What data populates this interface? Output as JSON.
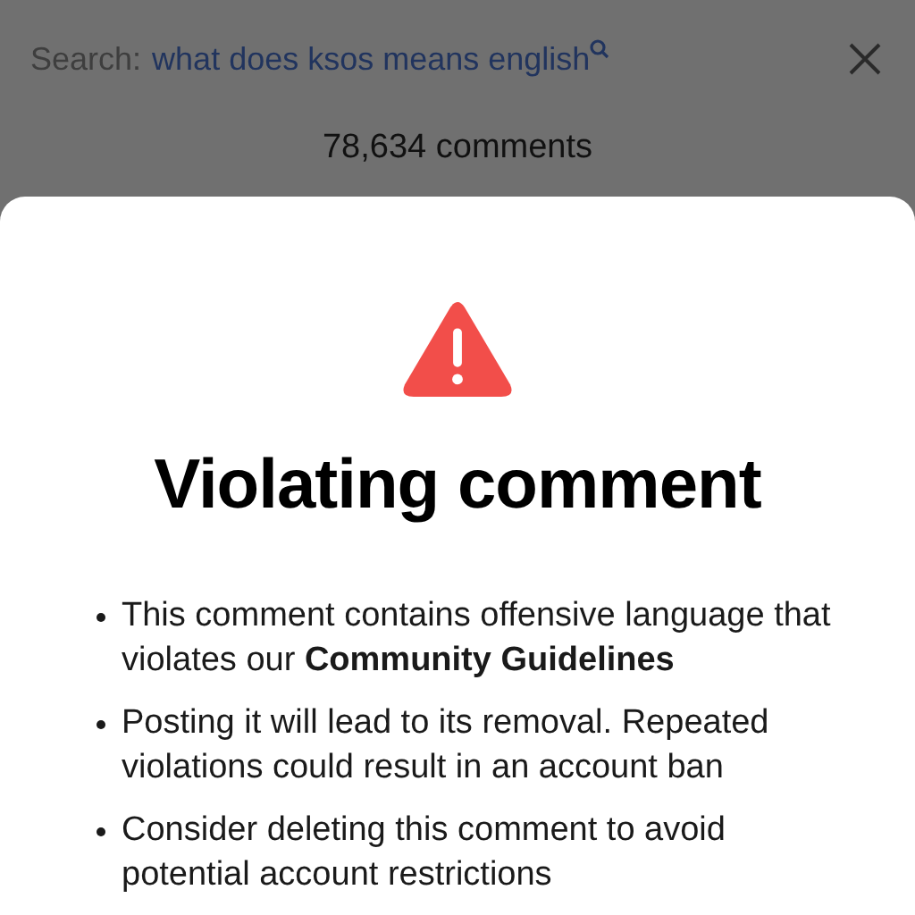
{
  "search_bar": {
    "label": "Search:",
    "query": "what does ksos means english"
  },
  "comment_count": "78,634 comments",
  "dialog": {
    "title": "Violating comment",
    "points": [
      "This comment contains offensive language that violates our **Community Guidelines**",
      "Posting it will lead to its removal. Repeated violations could result in an account ban",
      "Consider deleting this comment to avoid potential account restrictions"
    ]
  }
}
